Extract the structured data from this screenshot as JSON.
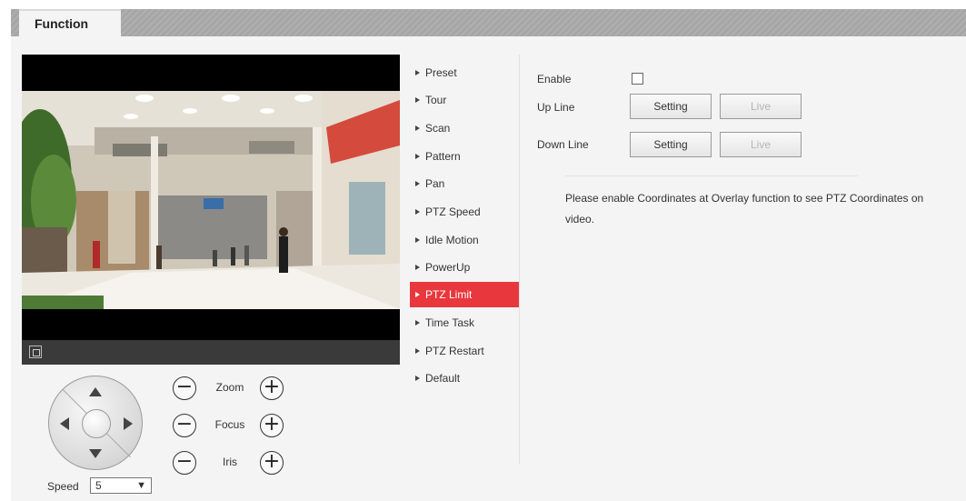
{
  "tabs": {
    "active": "Function"
  },
  "menu": {
    "items": [
      "Preset",
      "Tour",
      "Scan",
      "Pattern",
      "Pan",
      "PTZ Speed",
      "Idle Motion",
      "PowerUp",
      "PTZ Limit",
      "Time Task",
      "PTZ Restart",
      "Default"
    ],
    "active_index": 8,
    "active_color": "#e8383d"
  },
  "ptz": {
    "zoom_label": "Zoom",
    "focus_label": "Focus",
    "iris_label": "Iris",
    "minus": "−",
    "plus": "+",
    "speed_label": "Speed",
    "speed_value": "5"
  },
  "settings": {
    "enable_label": "Enable",
    "enable_checked": false,
    "up_line_label": "Up Line",
    "down_line_label": "Down Line",
    "setting_label": "Setting",
    "live_label": "Live",
    "note_line1": "Please enable Coordinates at Overlay function to see PTZ Coordinates on",
    "note_line2": "video."
  },
  "icons": {
    "fullscreen": "fullscreen-icon",
    "pan_up": "arrow-up-icon",
    "pan_down": "arrow-down-icon",
    "pan_left": "arrow-left-icon",
    "pan_right": "arrow-right-icon",
    "menu_bullet": "triangle-right-icon"
  }
}
